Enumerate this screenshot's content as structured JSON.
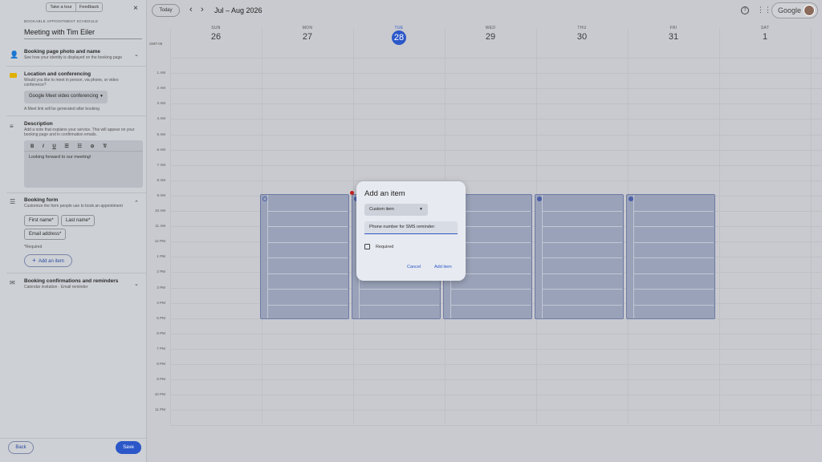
{
  "panel": {
    "take_tour": "Take a tour",
    "feedback": "Feedback",
    "close_symbol": "×",
    "overline": "BOOKABLE APPOINTMENT SCHEDULE",
    "title": "Meeting with Tim Eiler",
    "sections": {
      "photo": {
        "title": "Booking page photo and name",
        "desc": "See how your identity is displayed on the booking page"
      },
      "location": {
        "title": "Location and conferencing",
        "desc1": "Would you like to meet in person, via phone, or video",
        "desc2": "conference?",
        "dropdown": "Google Meet video conferencing",
        "note": "A Meet link will be generated after booking"
      },
      "description": {
        "title": "Description",
        "desc1": "Add a note that explains your service. This will appear on your",
        "desc2": "booking page and in confirmation emails.",
        "body": "Looking forward to our meeting!",
        "toolbar": [
          "B",
          "I",
          "U",
          "☰",
          "☷",
          "⊝",
          "T̸"
        ]
      },
      "form": {
        "title": "Booking form",
        "desc": "Customize the form people use to book an appointment",
        "fields": [
          "First name*",
          "Last name*",
          "Email address*"
        ],
        "required_note": "*Required",
        "add_item": "Add an item",
        "add_symbol": "+"
      },
      "confirm": {
        "title": "Booking confirmations and reminders",
        "desc": "Calendar invitation · Email reminder"
      }
    },
    "back": "Back",
    "save": "Save"
  },
  "header": {
    "today": "Today",
    "prev": "‹",
    "next": "›",
    "range": "Jul – Aug 2026",
    "account": "Google"
  },
  "calendar": {
    "timezone": "GMT-05",
    "days": [
      {
        "label": "SUN",
        "num": "26"
      },
      {
        "label": "MON",
        "num": "27"
      },
      {
        "label": "TUE",
        "num": "28"
      },
      {
        "label": "WED",
        "num": "29"
      },
      {
        "label": "THU",
        "num": "30"
      },
      {
        "label": "FRI",
        "num": "31"
      },
      {
        "label": "SAT",
        "num": "1"
      }
    ],
    "hours": [
      "1 AM",
      "2 AM",
      "3 AM",
      "4 AM",
      "5 AM",
      "6 AM",
      "7 AM",
      "8 AM",
      "9 AM",
      "10 AM",
      "11 AM",
      "12 PM",
      "1 PM",
      "2 PM",
      "3 PM",
      "4 PM",
      "5 PM",
      "6 PM",
      "7 PM",
      "8 PM",
      "9 PM",
      "10 PM",
      "11 PM"
    ],
    "accent": "#2b57c8"
  },
  "dialog": {
    "title": "Add an item",
    "type_select": "Custom item",
    "input_value": "Phone number for SMS reminder:",
    "required_label": "Required",
    "cancel": "Cancel",
    "add": "Add item"
  }
}
